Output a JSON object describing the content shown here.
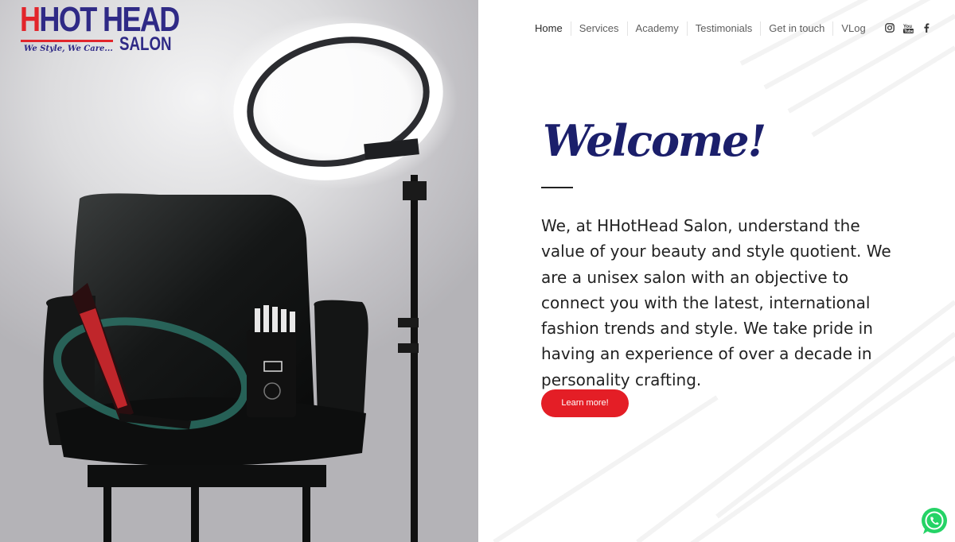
{
  "brand": {
    "logo_prefix": "H",
    "logo_main": "HOT HEAD",
    "logo_sub": "SALON",
    "tagline": "We Style, We Care...",
    "brand_red": "#e2252b",
    "brand_navy": "#2f2a86"
  },
  "nav": {
    "items": [
      {
        "label": "Home",
        "active": true
      },
      {
        "label": "Services",
        "active": false
      },
      {
        "label": "Academy",
        "active": false
      },
      {
        "label": "Testimonials",
        "active": false
      },
      {
        "label": "Get in touch",
        "active": false
      },
      {
        "label": "VLog",
        "active": false
      }
    ],
    "social": [
      "instagram-icon",
      "youtube-icon",
      "facebook-icon"
    ]
  },
  "welcome": {
    "title": "Welcome!",
    "body": "We, at HHotHead Salon, understand the value of your beauty and style quotient. We are a unisex salon with an objective to connect you with the latest, international fashion trends and style. We take pride in having an experience of over a decade in personality crafting.",
    "cta_label": "Learn more!",
    "cta_color": "#e41e26",
    "title_color": "#1b1f6b"
  },
  "floating": {
    "whatsapp_icon": "whatsapp-icon",
    "whatsapp_color": "#25d366"
  }
}
